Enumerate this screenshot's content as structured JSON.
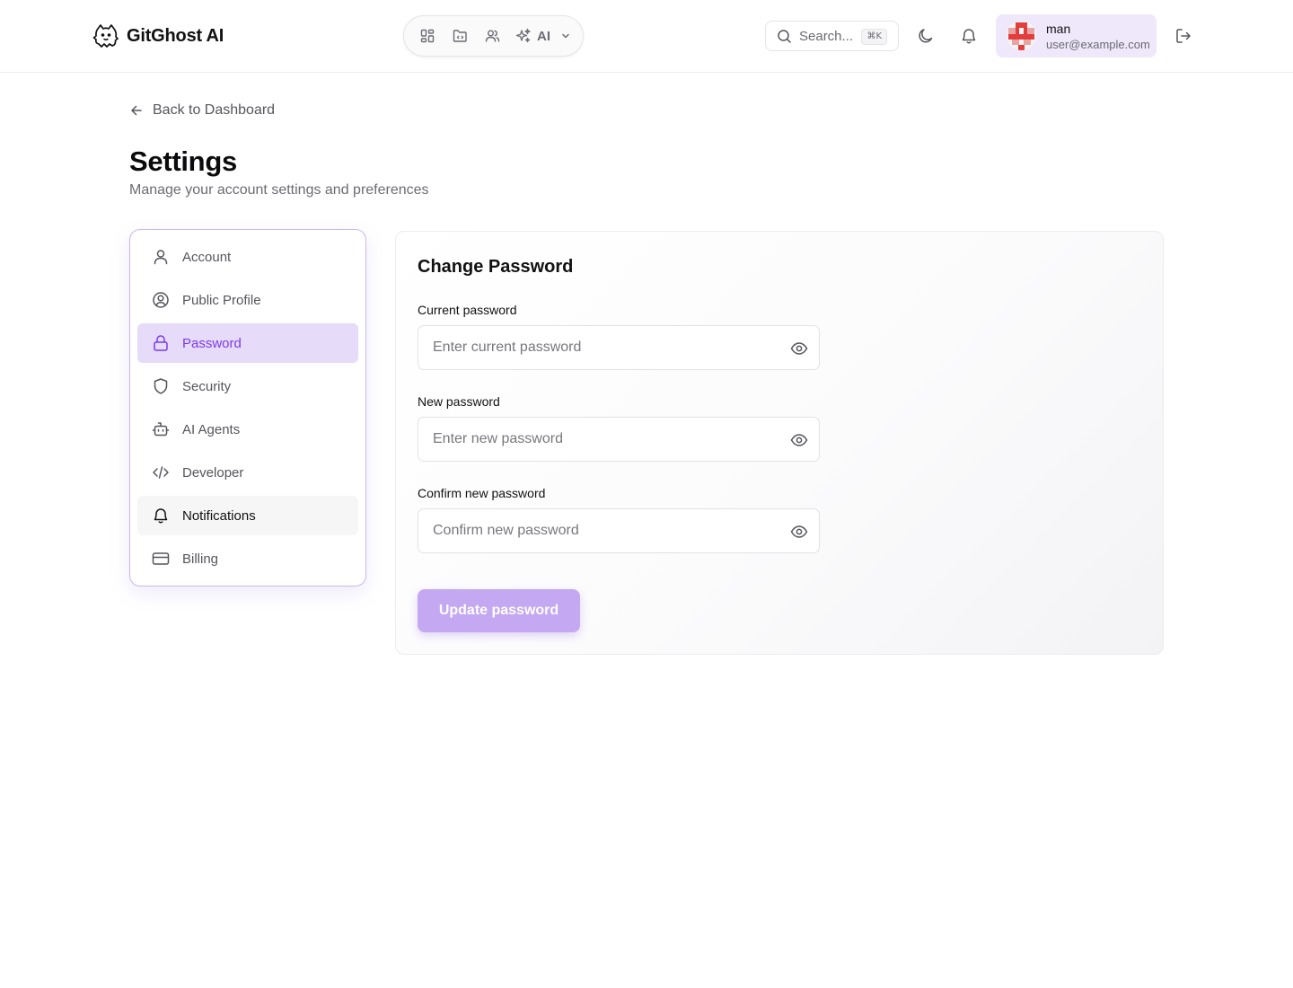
{
  "header": {
    "brand": "GitGhost AI",
    "nav": {
      "items": [
        "dashboard-icon",
        "repository-icon",
        "users-icon"
      ],
      "ai_label": "AI"
    },
    "search": {
      "placeholder": "Search...",
      "shortcut": "⌘K"
    },
    "user": {
      "name": "man",
      "email": "user@example.com"
    }
  },
  "page": {
    "back_label": "Back to Dashboard",
    "title": "Settings",
    "subtitle": "Manage your account settings and preferences"
  },
  "sidebar": {
    "items": [
      {
        "label": "Account",
        "icon": "user-icon"
      },
      {
        "label": "Public Profile",
        "icon": "user-circle-icon"
      },
      {
        "label": "Password",
        "icon": "lock-icon",
        "active": true
      },
      {
        "label": "Security",
        "icon": "shield-icon"
      },
      {
        "label": "AI Agents",
        "icon": "bot-icon"
      },
      {
        "label": "Developer",
        "icon": "code-icon"
      },
      {
        "label": "Notifications",
        "icon": "bell-icon",
        "hovered": true
      },
      {
        "label": "Billing",
        "icon": "credit-card-icon"
      }
    ]
  },
  "form": {
    "title": "Change Password",
    "current": {
      "label": "Current password",
      "placeholder": "Enter current password",
      "value": ""
    },
    "new": {
      "label": "New password",
      "placeholder": "Enter new password",
      "value": ""
    },
    "confirm": {
      "label": "Confirm new password",
      "placeholder": "Confirm new password",
      "value": ""
    },
    "submit_label": "Update password"
  },
  "colors": {
    "accent": "#7c3aed",
    "active_bg": "#e6dbf8",
    "button_bg": "#c4a8f1",
    "user_bg": "#efe8fb",
    "sidebar_border": "#c9b7f1"
  }
}
